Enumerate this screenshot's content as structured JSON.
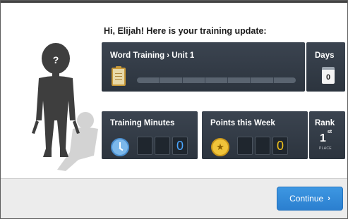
{
  "greeting": "Hi, Elijah! Here is your training update:",
  "avatar": {
    "badge": "?"
  },
  "word_training": {
    "title": "Word Training › Unit 1",
    "icon": "clipboard-icon",
    "progress_fraction": 0
  },
  "days": {
    "title": "Days",
    "value": "0",
    "icon": "calendar-icon"
  },
  "minutes": {
    "title": "Training Minutes",
    "digits": [
      "",
      "",
      "0"
    ],
    "icon": "clock-icon"
  },
  "points": {
    "title": "Points this Week",
    "digits": [
      "",
      "",
      "0"
    ],
    "icon": "star-icon"
  },
  "rank": {
    "title": "Rank",
    "value": "1",
    "suffix": "st",
    "place_label": "PLACE"
  },
  "footer": {
    "continue_label": "Continue",
    "continue_icon": "chevron-right-icon"
  },
  "colors": {
    "panel": "#323a45",
    "accent_blue": "#3a8fd9",
    "digit_blue": "#4aa6ff",
    "digit_gold": "#f2c21b"
  }
}
